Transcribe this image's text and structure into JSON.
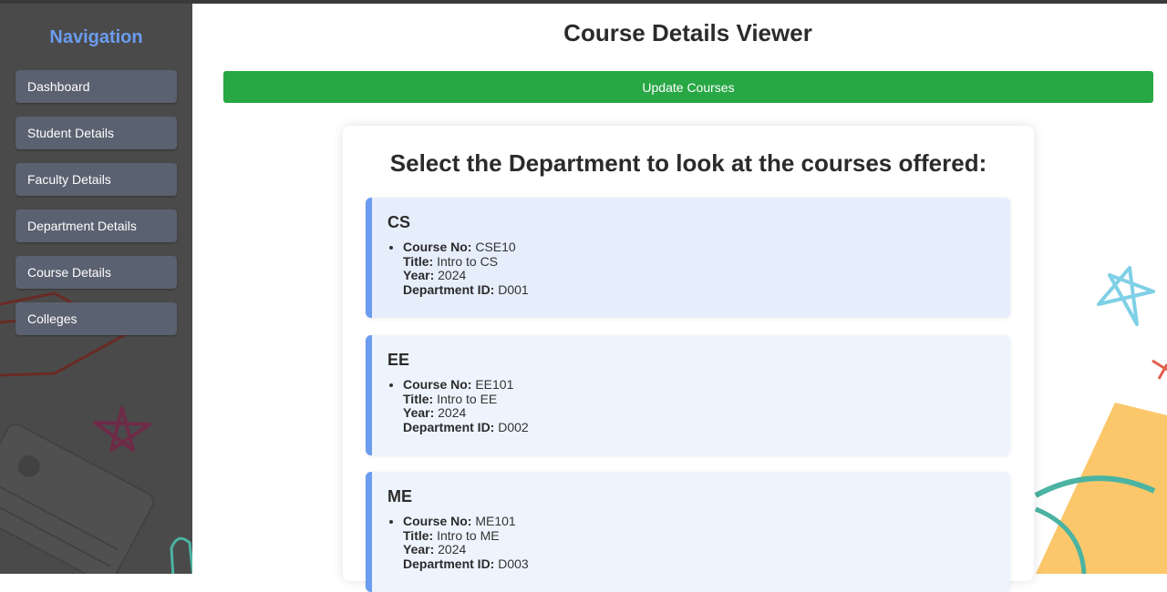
{
  "sidebar": {
    "title": "Navigation",
    "items": [
      {
        "label": "Dashboard"
      },
      {
        "label": "Student Details"
      },
      {
        "label": "Faculty Details"
      },
      {
        "label": "Department Details"
      },
      {
        "label": "Course Details"
      },
      {
        "label": "Colleges"
      }
    ]
  },
  "main": {
    "title": "Course Details Viewer",
    "update_button": "Update Courses",
    "panel_heading": "Select the Department to look at the courses offered:",
    "field_labels": {
      "course_no": "Course No:",
      "title": "Title:",
      "year": "Year:",
      "department_id": "Department ID:"
    },
    "departments": [
      {
        "name": "CS",
        "course_no": "CSE10",
        "title": "Intro to CS",
        "year": "2024",
        "department_id": "D001"
      },
      {
        "name": "EE",
        "course_no": "EE101",
        "title": "Intro to EE",
        "year": "2024",
        "department_id": "D002"
      },
      {
        "name": "ME",
        "course_no": "ME101",
        "title": "Intro to ME",
        "year": "2024",
        "department_id": "D003"
      }
    ]
  },
  "colors": {
    "nav_title": "#6b9cf0",
    "update_button_bg": "#28a745",
    "card_accent": "#6b9cf0",
    "sidebar_bg": "#4a4a4a"
  }
}
